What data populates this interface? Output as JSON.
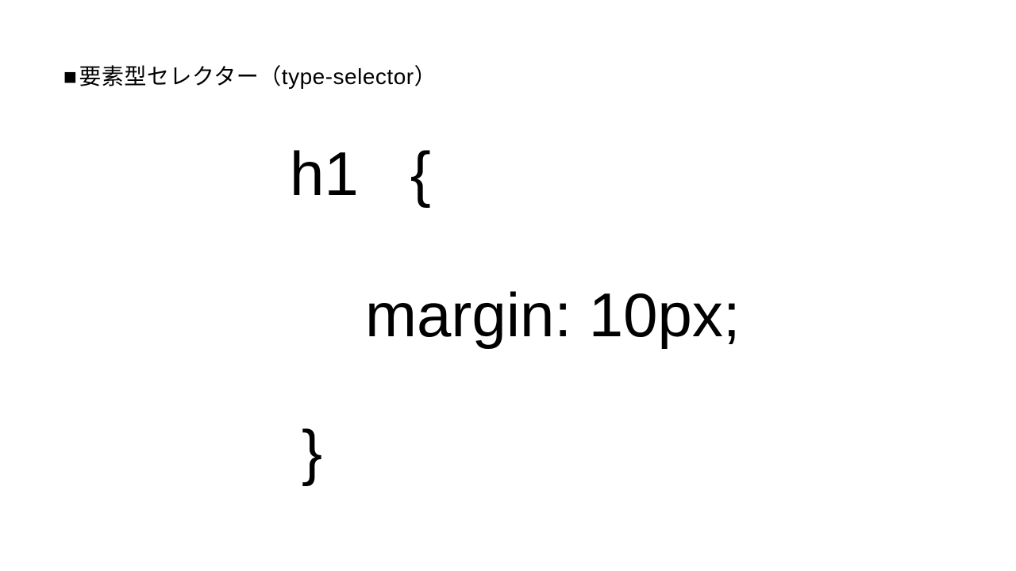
{
  "heading": {
    "bullet": "■",
    "text": "要素型セレクター（type-selector）"
  },
  "code": {
    "line1": "h1   {",
    "line2": "margin: 10px;",
    "line3": "}"
  }
}
